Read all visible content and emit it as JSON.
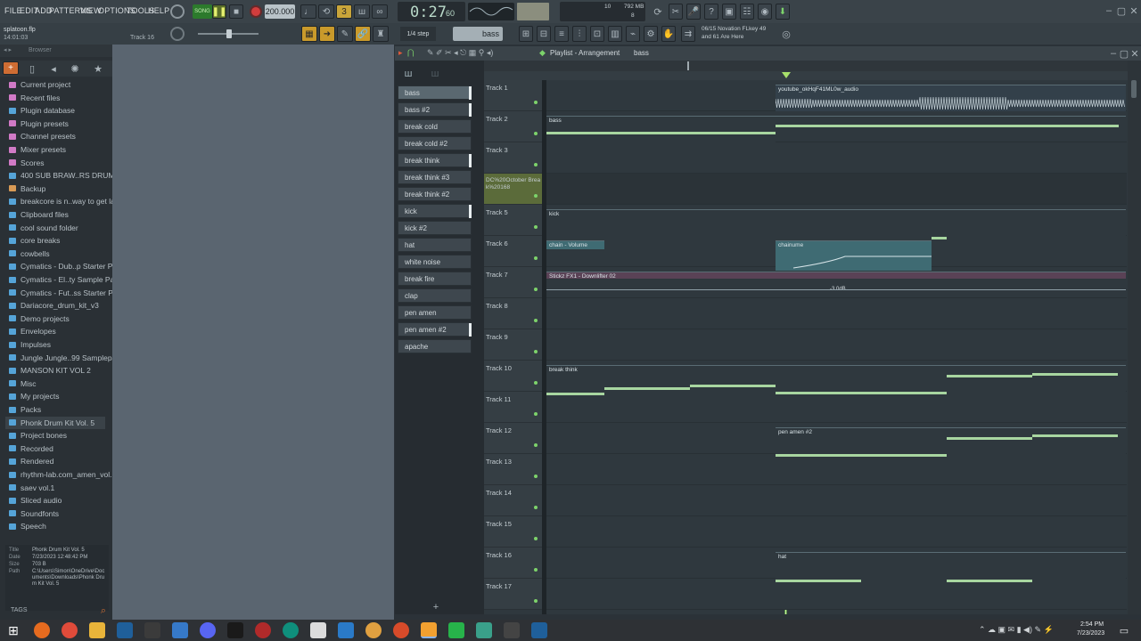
{
  "menu": [
    "FILE",
    "EDIT",
    "ADD",
    "PATTERNS",
    "VIEW",
    "OPTIONS",
    "TOOLS",
    "HELP"
  ],
  "transport": {
    "mode": "SONG",
    "tempo": "200.000",
    "time": "0:27",
    "time_small": "60",
    "cpu_label": "10",
    "mem_label": "792 MB",
    "mem_small": "8"
  },
  "project": {
    "file": "splatoon.flp",
    "time": "14:01:03",
    "track_hint": "Track 16"
  },
  "step": "1/4 step",
  "pattern_name": "bass",
  "hint": {
    "line1": "06/15  Novation FLkey 49",
    "line2": "and 61 Are Here"
  },
  "browser": {
    "title": "Browser",
    "items": [
      {
        "label": "Current project",
        "color": "#d17ac6"
      },
      {
        "label": "Recent files",
        "color": "#d17ac6"
      },
      {
        "label": "Plugin database",
        "color": "#55a4d8"
      },
      {
        "label": "Plugin presets",
        "color": "#d17ac6"
      },
      {
        "label": "Channel presets",
        "color": "#d17ac6"
      },
      {
        "label": "Mixer presets",
        "color": "#d17ac6"
      },
      {
        "label": "Scores",
        "color": "#d17ac6"
      },
      {
        "label": "400 SUB BRAW..RS DRUM KIT",
        "color": "#55a4d8"
      },
      {
        "label": "Backup",
        "color": "#d89a55"
      },
      {
        "label": "breakcore is n..way to get laid",
        "color": "#55a4d8"
      },
      {
        "label": "Clipboard files",
        "color": "#55a4d8"
      },
      {
        "label": "cool sound folder",
        "color": "#55a4d8"
      },
      {
        "label": "core breaks",
        "color": "#55a4d8"
      },
      {
        "label": "cowbells",
        "color": "#55a4d8"
      },
      {
        "label": "Cymatics - Dub..p Starter Pack",
        "color": "#55a4d8"
      },
      {
        "label": "Cymatics - El..ty Sample Pack",
        "color": "#55a4d8"
      },
      {
        "label": "Cymatics - Fut..ss Starter Pack",
        "color": "#55a4d8"
      },
      {
        "label": "Dariacore_drum_kit_v3",
        "color": "#55a4d8"
      },
      {
        "label": "Demo projects",
        "color": "#55a4d8"
      },
      {
        "label": "Envelopes",
        "color": "#55a4d8"
      },
      {
        "label": "Impulses",
        "color": "#55a4d8"
      },
      {
        "label": "Jungle Jungle..99 Samplepack",
        "color": "#55a4d8"
      },
      {
        "label": "MANSON KIT VOL 2",
        "color": "#55a4d8"
      },
      {
        "label": "Misc",
        "color": "#55a4d8"
      },
      {
        "label": "My projects",
        "color": "#55a4d8"
      },
      {
        "label": "Packs",
        "color": "#55a4d8"
      },
      {
        "label": "Phonk Drum Kit Vol. 5",
        "color": "#55a4d8"
      },
      {
        "label": "Project bones",
        "color": "#55a4d8"
      },
      {
        "label": "Recorded",
        "color": "#55a4d8"
      },
      {
        "label": "Rendered",
        "color": "#55a4d8"
      },
      {
        "label": "rhythm-lab.com_amen_vol.1",
        "color": "#55a4d8"
      },
      {
        "label": "saev vol.1",
        "color": "#55a4d8"
      },
      {
        "label": "Sliced audio",
        "color": "#55a4d8"
      },
      {
        "label": "Soundfonts",
        "color": "#55a4d8"
      },
      {
        "label": "Speech",
        "color": "#55a4d8"
      }
    ],
    "info": {
      "title_k": "Title",
      "title_v": "Phonk Drum Kit Vol. 5",
      "date_k": "Date",
      "date_v": "7/23/2023 12:48:42 PM",
      "size_k": "Size",
      "size_v": "703 B",
      "path_k": "Path",
      "path_v": "C:\\Users\\Simon\\OneDrive\\Documents\\Downloads\\Phonk Drum Kit Vol. 5"
    },
    "tags": "TAGS"
  },
  "channels": [
    "bass",
    "bass #2",
    "break cold",
    "break cold #2",
    "break think",
    "break think #3",
    "break think #2",
    "kick",
    "kick #2",
    "hat",
    "white noise",
    "break fire",
    "clap",
    "pen amen",
    "pen amen #2",
    "apache"
  ],
  "playlist": {
    "title": "Playlist - Arrangement",
    "pattern": "bass",
    "tracks": [
      "Track 1",
      "Track 2",
      "Track 3",
      "DC%20October Break%20168",
      "Track 5",
      "Track 6",
      "Track 7",
      "Track 8",
      "Track 9",
      "Track 10",
      "Track 11",
      "Track 12",
      "Track 13",
      "Track 14",
      "Track 15",
      "Track 16",
      "Track 17"
    ],
    "clips": {
      "audio": "youtube_okHqF41ML0w_audio",
      "bass": "bass",
      "kick": "kick",
      "chain1": "chain - Volume",
      "chain2": "chainume",
      "stickz": "Stickz FX1 - Downlifter 02",
      "db": "-3.0dB",
      "break": "break think",
      "amen": "pen amen #2",
      "hat": "hat"
    }
  },
  "clock": {
    "time": "2:54 PM",
    "date": "7/23/2023"
  }
}
